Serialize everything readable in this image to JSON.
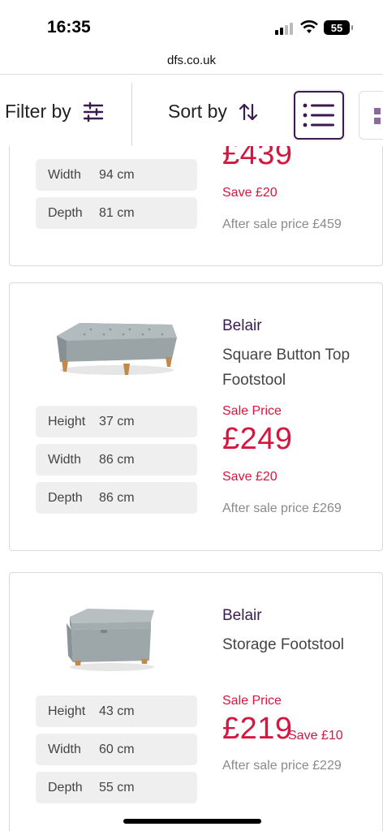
{
  "status": {
    "time": "16:35",
    "battery": "55"
  },
  "browser": {
    "url": "dfs.co.uk"
  },
  "toolbar": {
    "filter_label": "Filter by",
    "sort_label": "Sort by"
  },
  "products": [
    {
      "dims": [
        {
          "label": "Width",
          "value": "94 cm"
        },
        {
          "label": "Depth",
          "value": "81 cm"
        }
      ],
      "price": "£439",
      "save": "Save £20",
      "after": "After sale price £459"
    },
    {
      "brand": "Belair",
      "name": "Square Button Top Footstool",
      "sale_label": "Sale Price",
      "price": "£249",
      "save": "Save £20",
      "after": "After sale price £269",
      "dims": [
        {
          "label": "Height",
          "value": "37 cm"
        },
        {
          "label": "Width",
          "value": "86 cm"
        },
        {
          "label": "Depth",
          "value": "86 cm"
        }
      ]
    },
    {
      "brand": "Belair",
      "name": "Storage Footstool",
      "sale_label": "Sale Price",
      "price": "£219",
      "save": "Save £10",
      "after": "After sale price £229",
      "dims": [
        {
          "label": "Height",
          "value": "43 cm"
        },
        {
          "label": "Width",
          "value": "60 cm"
        },
        {
          "label": "Depth",
          "value": "55 cm"
        }
      ]
    }
  ],
  "colors": {
    "brand_purple": "#3b1b4f",
    "sale_red": "#d6163f",
    "muted_grey": "#8a8a8a",
    "chip_bg": "#efefef"
  }
}
